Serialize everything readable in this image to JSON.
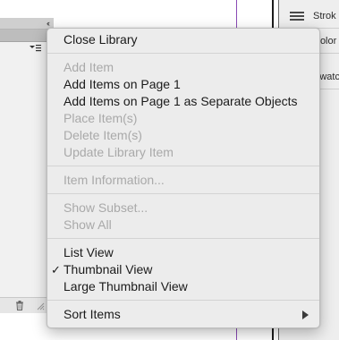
{
  "library_panel": {
    "collapse_glyph": "‹‹"
  },
  "right_panel": {
    "rows": [
      {
        "label": "Strok"
      },
      {
        "label": "Color"
      },
      {
        "label": "Swatc"
      }
    ]
  },
  "context_menu": {
    "items": [
      {
        "label": "Close Library",
        "enabled": true
      },
      {
        "label": "Add Item",
        "enabled": false
      },
      {
        "label": "Add Items on Page 1",
        "enabled": true
      },
      {
        "label": "Add Items on Page 1 as Separate Objects",
        "enabled": true
      },
      {
        "label": "Place Item(s)",
        "enabled": false
      },
      {
        "label": "Delete Item(s)",
        "enabled": false
      },
      {
        "label": "Update Library Item",
        "enabled": false
      },
      {
        "label": "Item Information...",
        "enabled": false
      },
      {
        "label": "Show Subset...",
        "enabled": false
      },
      {
        "label": "Show All",
        "enabled": false
      },
      {
        "label": "List View",
        "enabled": true
      },
      {
        "label": "Thumbnail View",
        "enabled": true,
        "checked": true,
        "check_glyph": "✓"
      },
      {
        "label": "Large Thumbnail View",
        "enabled": true
      },
      {
        "label": "Sort Items",
        "enabled": true,
        "has_submenu": true
      }
    ]
  },
  "colors": {
    "guide": "#8a4bb5",
    "menu_bg": "#ececec",
    "disabled_text": "#a9a9a9"
  }
}
